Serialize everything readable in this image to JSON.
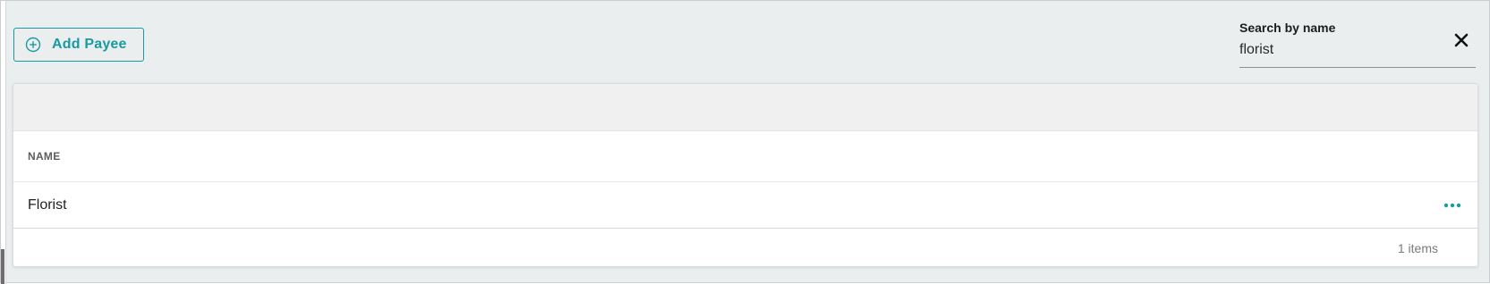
{
  "toolbar": {
    "add_button_label": "Add Payee"
  },
  "search": {
    "label": "Search by name",
    "value": "florist",
    "clear_icon": "close-icon"
  },
  "table": {
    "columns": [
      "NAME"
    ],
    "rows": [
      {
        "name": "Florist",
        "actions_icon": "more-horizontal-icon"
      }
    ],
    "footer_count": "1 items"
  },
  "colors": {
    "accent": "#1a9aa0",
    "background": "#ebeeef",
    "card": "#ffffff",
    "toolbar_band": "#f0f0f0"
  }
}
